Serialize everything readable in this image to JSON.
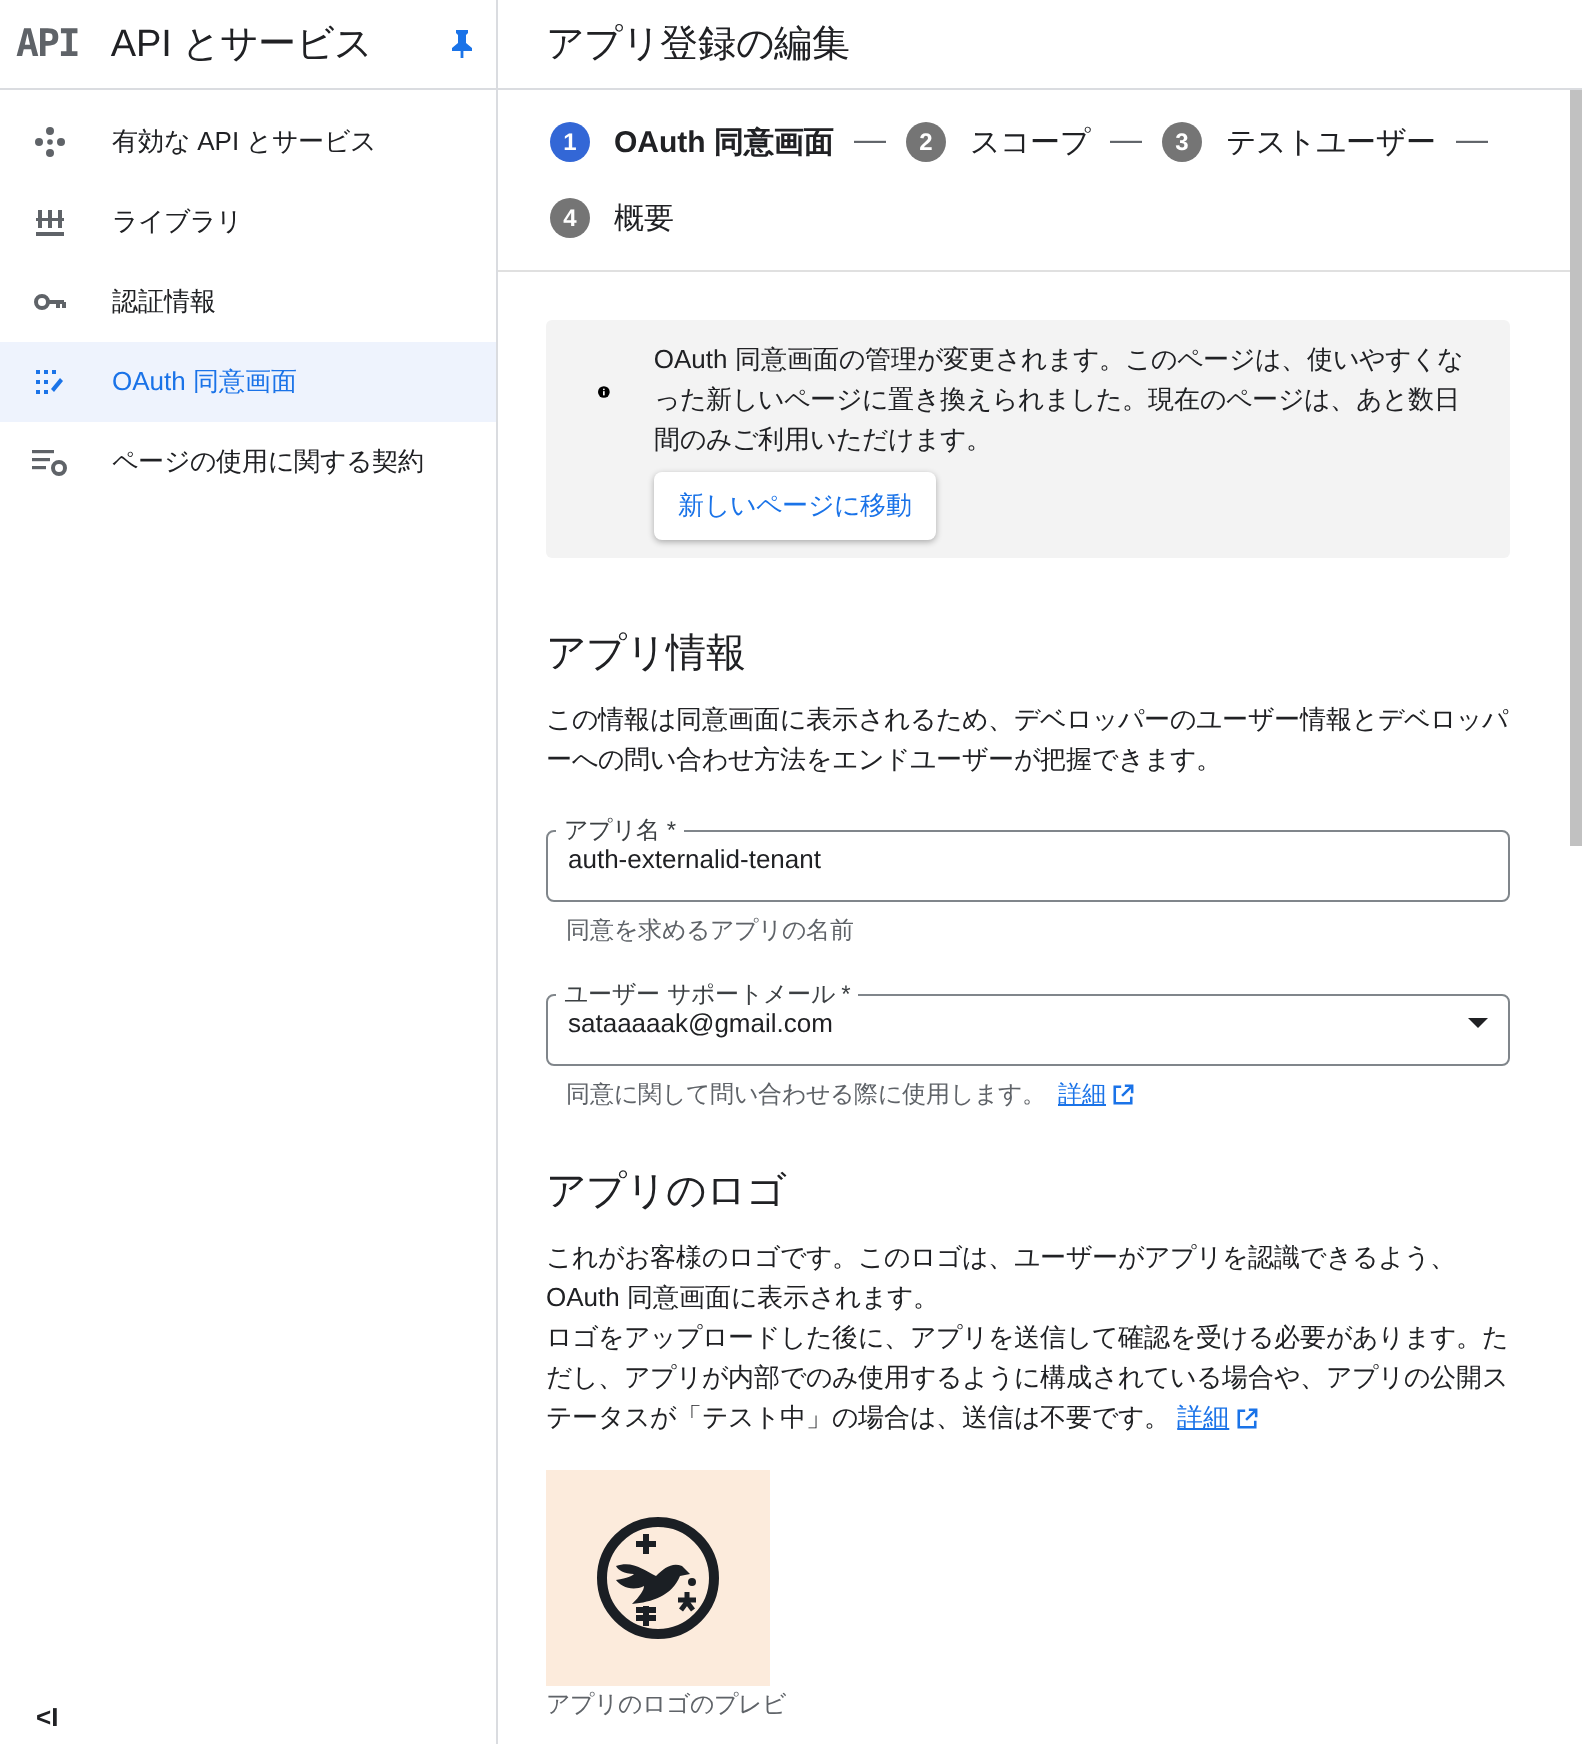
{
  "sidebar": {
    "logo": "API",
    "title": "API とサービス",
    "pinned": true,
    "items": [
      {
        "label": "有効な API とサービス",
        "selected": false
      },
      {
        "label": "ライブラリ",
        "selected": false
      },
      {
        "label": "認証情報",
        "selected": false
      },
      {
        "label": "OAuth 同意画面",
        "selected": true
      },
      {
        "label": "ページの使用に関する契約",
        "selected": false
      }
    ],
    "collapse": "<I"
  },
  "page_title": "アプリ登録の編集",
  "steps": [
    {
      "number": "1",
      "label": "OAuth 同意画面",
      "selected": true,
      "separator": "—"
    },
    {
      "number": "2",
      "label": "スコープ",
      "selected": false,
      "separator": "—"
    },
    {
      "number": "3",
      "label": "テストユーザー",
      "selected": false,
      "separator": "—"
    },
    {
      "number": "4",
      "label": "概要",
      "selected": false
    }
  ],
  "notice": {
    "text": "OAuth 同意画面の管理が変更されます。このページは、使いやすくなった新しいページに置き換えられました。現在のページは、あと数日間のみご利用いただけます。",
    "button": "新しいページに移動"
  },
  "app_info": {
    "heading": "アプリ情報",
    "description": "この情報は同意画面に表示されるため、デベロッパーのユーザー情報とデベロッパーへの問い合わせ方法をエンドユーザーが把握できます。",
    "fields": [
      {
        "kind": "text",
        "label": "アプリ名 *",
        "value": "auth-externalid-tenant",
        "hint": "同意を求めるアプリの名前"
      },
      {
        "kind": "select",
        "label": "ユーザー サポートメール *",
        "value": "sataaaaak@gmail.com",
        "hint": "同意に関して問い合わせる際に使用します。",
        "link": "詳細"
      }
    ]
  },
  "app_logo": {
    "heading": "アプリのロゴ",
    "lines": [
      "これがお客様のロゴです。このロゴは、ユーザーがアプリを認識できるよう、OAuth 同意画面に表示されます。",
      "ロゴをアップロードした後に、アプリを送信して確認を受ける必要があります。ただし、アプリが内部でのみ使用するように構成されている場合や、アプリの公開ステータスが「テスト中」の場合は、送信は不要です。"
    ],
    "link": "詳細",
    "preview_caption": "アプリのロゴのプレビ"
  }
}
